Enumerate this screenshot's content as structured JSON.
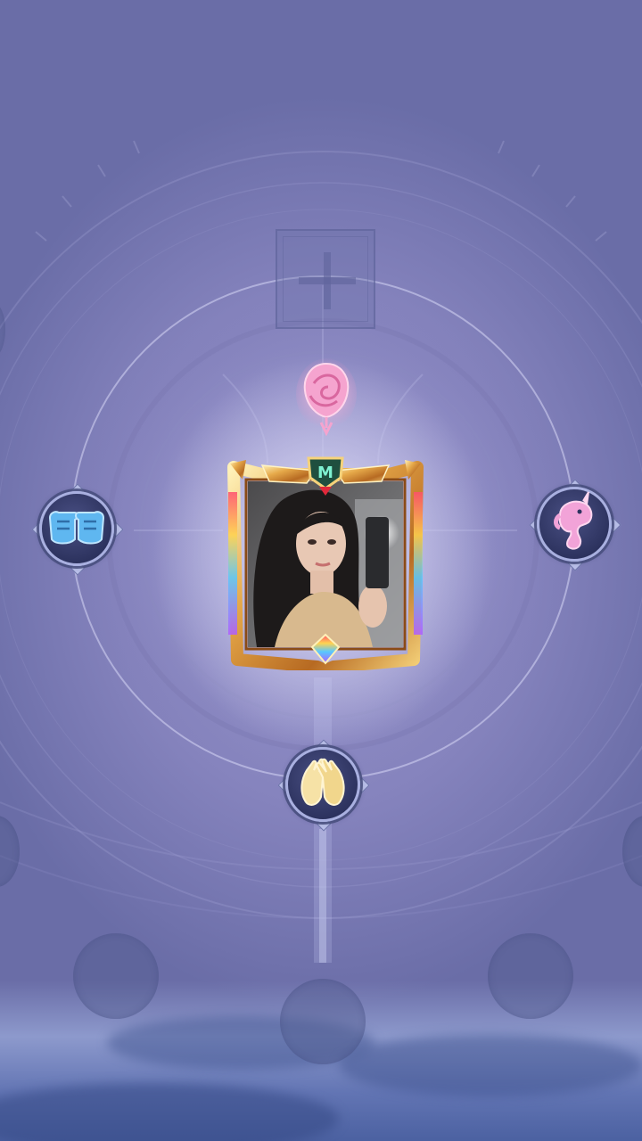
{
  "screen": {
    "name": "emote-wheel-editor"
  },
  "center": {
    "avatar": {
      "photo_subject": "selfie-portrait",
      "frame_style": "gold-crest-frame"
    },
    "badge_icon": "rose-badge-icon",
    "add_slot_icon": "plus-icon"
  },
  "wheel": {
    "slots": [
      {
        "position": "left",
        "icon": "fist-bump-icon",
        "color": "#5fb7f0"
      },
      {
        "position": "right",
        "icon": "unicorn-icon",
        "color": "#f2a3d8"
      },
      {
        "position": "bottom",
        "icon": "clapping-hands-icon",
        "color": "#f6e2a6"
      }
    ],
    "empty_slots": [
      "empty-slot-left",
      "empty-slot-center",
      "empty-slot-right"
    ]
  },
  "colors": {
    "accent_rose": "#f28fc4",
    "frame_gold": "#e6a94a",
    "slot_ring": "#a9b0e0"
  }
}
